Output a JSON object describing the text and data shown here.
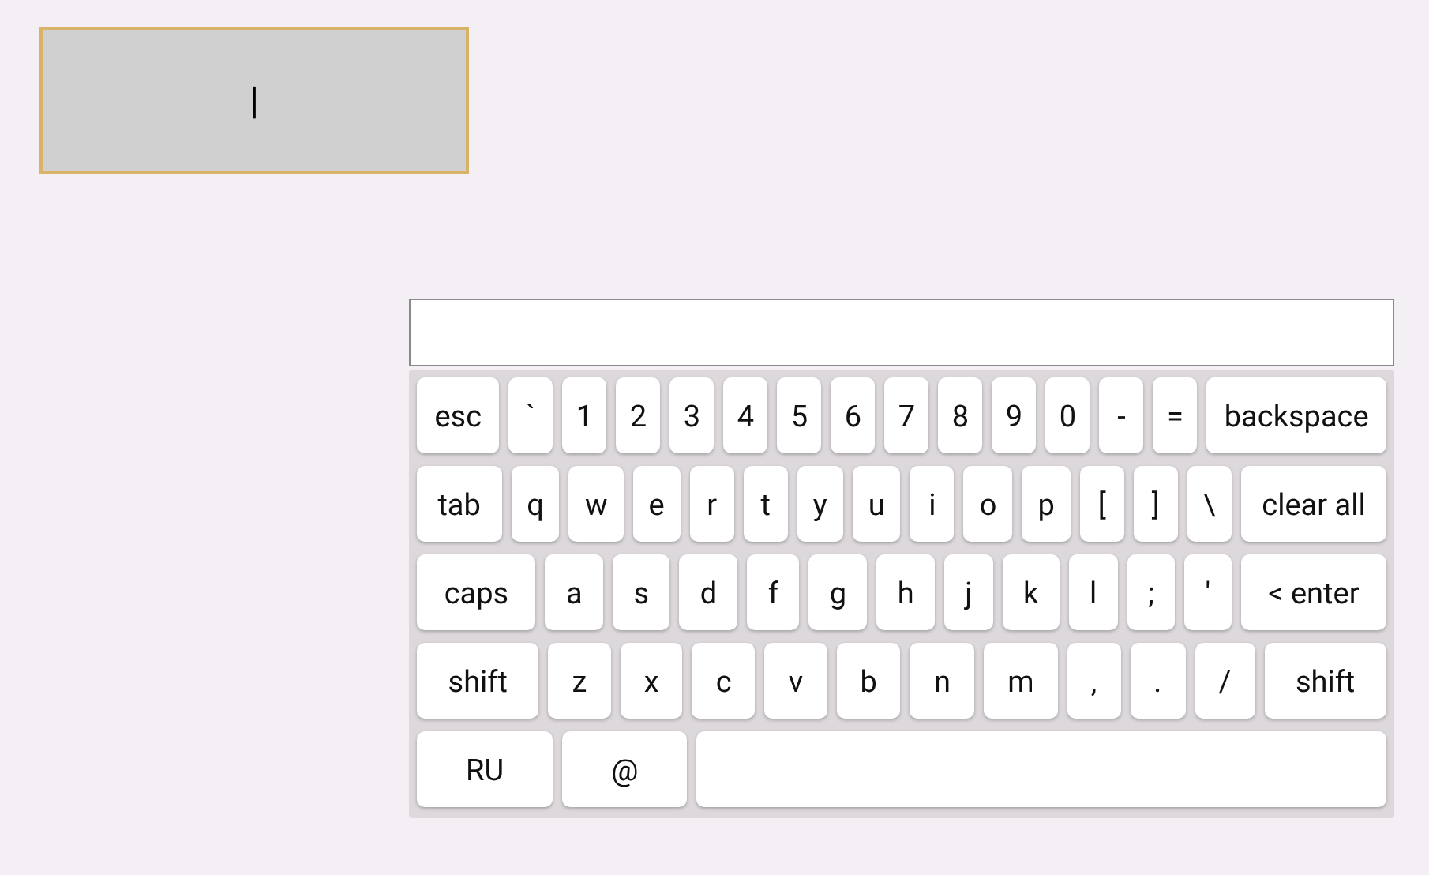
{
  "display": {
    "value": "|"
  },
  "keyboard": {
    "rows": [
      {
        "keys": [
          {
            "label": "esc",
            "kind": "wide"
          },
          {
            "label": "`",
            "kind": "char"
          },
          {
            "label": "1",
            "kind": "char"
          },
          {
            "label": "2",
            "kind": "char"
          },
          {
            "label": "3",
            "kind": "char"
          },
          {
            "label": "4",
            "kind": "char"
          },
          {
            "label": "5",
            "kind": "char"
          },
          {
            "label": "6",
            "kind": "char"
          },
          {
            "label": "7",
            "kind": "char"
          },
          {
            "label": "8",
            "kind": "char"
          },
          {
            "label": "9",
            "kind": "char"
          },
          {
            "label": "0",
            "kind": "char"
          },
          {
            "label": "-",
            "kind": "char"
          },
          {
            "label": "=",
            "kind": "char"
          },
          {
            "label": "backspace",
            "kind": "wide"
          }
        ]
      },
      {
        "keys": [
          {
            "label": "tab",
            "kind": "wide"
          },
          {
            "label": "q",
            "kind": "char"
          },
          {
            "label": "w",
            "kind": "char"
          },
          {
            "label": "e",
            "kind": "char"
          },
          {
            "label": "r",
            "kind": "char"
          },
          {
            "label": "t",
            "kind": "char"
          },
          {
            "label": "y",
            "kind": "char"
          },
          {
            "label": "u",
            "kind": "char"
          },
          {
            "label": "i",
            "kind": "char"
          },
          {
            "label": "o",
            "kind": "char"
          },
          {
            "label": "p",
            "kind": "char"
          },
          {
            "label": "[",
            "kind": "char"
          },
          {
            "label": "]",
            "kind": "char"
          },
          {
            "label": "\\",
            "kind": "char"
          },
          {
            "label": "clear all",
            "kind": "wide"
          }
        ]
      },
      {
        "keys": [
          {
            "label": "caps",
            "kind": "wide"
          },
          {
            "label": "a",
            "kind": "char"
          },
          {
            "label": "s",
            "kind": "char"
          },
          {
            "label": "d",
            "kind": "char"
          },
          {
            "label": "f",
            "kind": "char"
          },
          {
            "label": "g",
            "kind": "char"
          },
          {
            "label": "h",
            "kind": "char"
          },
          {
            "label": "j",
            "kind": "char"
          },
          {
            "label": "k",
            "kind": "char"
          },
          {
            "label": "l",
            "kind": "char"
          },
          {
            "label": ";",
            "kind": "char"
          },
          {
            "label": "'",
            "kind": "char"
          },
          {
            "label": "< enter",
            "kind": "wide"
          }
        ]
      },
      {
        "keys": [
          {
            "label": "shift",
            "kind": "wide"
          },
          {
            "label": "z",
            "kind": "char"
          },
          {
            "label": "x",
            "kind": "char"
          },
          {
            "label": "c",
            "kind": "char"
          },
          {
            "label": "v",
            "kind": "char"
          },
          {
            "label": "b",
            "kind": "char"
          },
          {
            "label": "n",
            "kind": "char"
          },
          {
            "label": "m",
            "kind": "char"
          },
          {
            "label": ",",
            "kind": "char"
          },
          {
            "label": ".",
            "kind": "char"
          },
          {
            "label": "/",
            "kind": "char"
          },
          {
            "label": "shift",
            "kind": "wide"
          }
        ]
      },
      {
        "keys": [
          {
            "label": "RU",
            "kind": "wide"
          },
          {
            "label": "@",
            "kind": "wide"
          },
          {
            "kind": "space"
          }
        ]
      }
    ]
  }
}
